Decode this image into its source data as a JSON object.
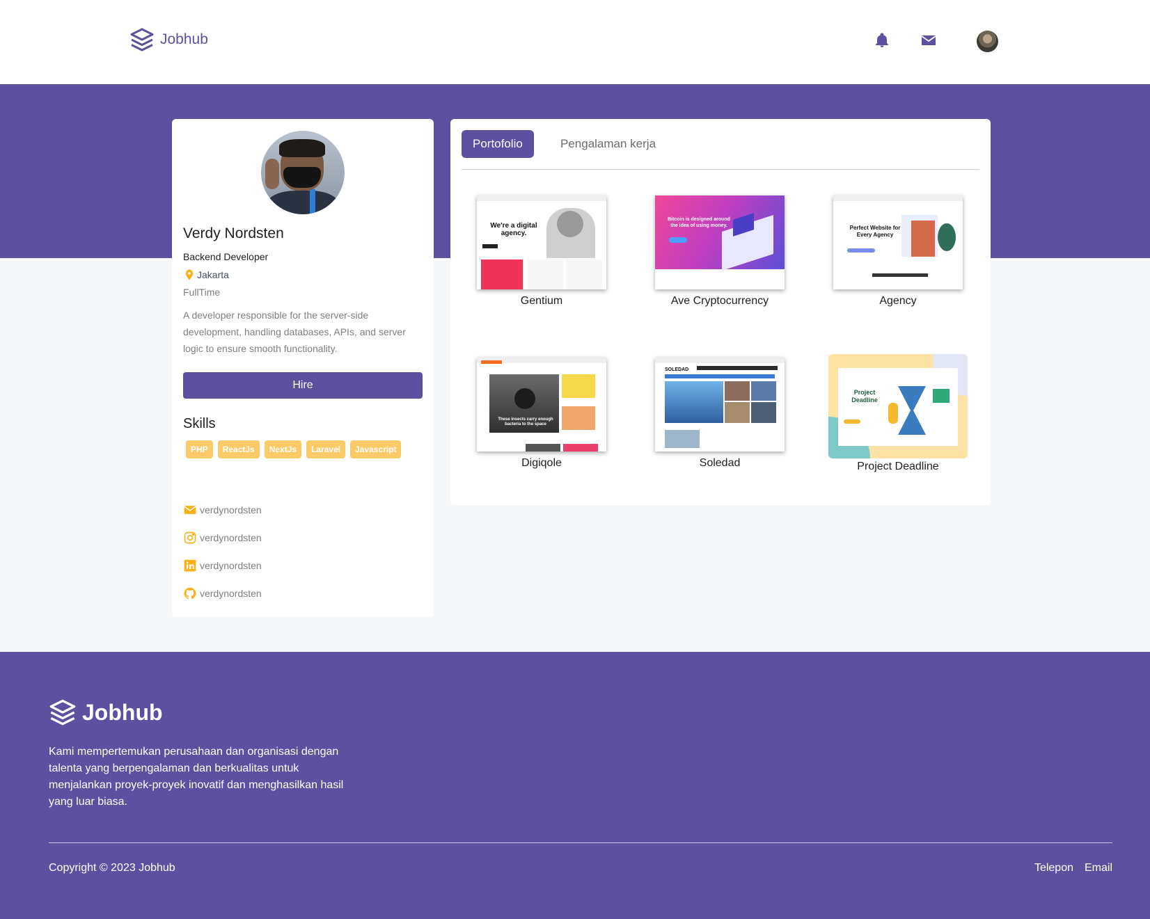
{
  "navbar": {
    "brand": "Jobhub",
    "icons": [
      "bell-icon",
      "mail-icon"
    ],
    "colors": {
      "brand": "#5e50a1"
    }
  },
  "profile": {
    "name": "Verdy Nordsten",
    "role": "Backend Developer",
    "location": "Jakarta",
    "job_type": "FullTime",
    "description": "A developer responsible for the server-side development, handling databases, APIs, and server logic to ensure smooth functionality.",
    "hire_label": "Hire",
    "skills_title": "Skills",
    "skills": [
      "PHP",
      "ReactJs",
      "NextJs",
      "Laravel",
      "Javascript"
    ],
    "contacts": [
      {
        "icon": "mail-icon",
        "value": "verdynordsten"
      },
      {
        "icon": "instagram-icon",
        "value": "verdynordsten"
      },
      {
        "icon": "linkedin-icon",
        "value": "verdynordsten"
      },
      {
        "icon": "github-icon",
        "value": "verdynordsten"
      }
    ]
  },
  "portfolio": {
    "tabs": [
      "Portofolio",
      "Pengalaman kerja"
    ],
    "active_tab": "Portofolio",
    "items": [
      {
        "title": "Gentium",
        "thumb_text": "We're a digital agency."
      },
      {
        "title": "Ave Cryptocurrency",
        "thumb_text": "Bitcoin is designed around the idea of using money."
      },
      {
        "title": "Agency",
        "thumb_text": "Perfect Website for Every Agency"
      },
      {
        "title": "Digiqole",
        "thumb_text": "These insects carry enough bacteria to the space"
      },
      {
        "title": "Soledad",
        "thumb_text": "SOLEDAD"
      },
      {
        "title": "Project Deadline",
        "thumb_text": "Project Deadline"
      }
    ]
  },
  "footer": {
    "brand": "Jobhub",
    "description": "Kami mempertemukan perusahaan dan organisasi dengan talenta yang berpengalaman dan berkualitas untuk menjalankan proyek-proyek inovatif dan menghasilkan hasil yang luar biasa.",
    "copyright": "Copyright © 2023 Jobhub",
    "links": [
      "Telepon",
      "Email"
    ]
  },
  "colors": {
    "primary": "#5e50a1",
    "skill": "#fbb017",
    "icon_accent": "#fbb017"
  }
}
